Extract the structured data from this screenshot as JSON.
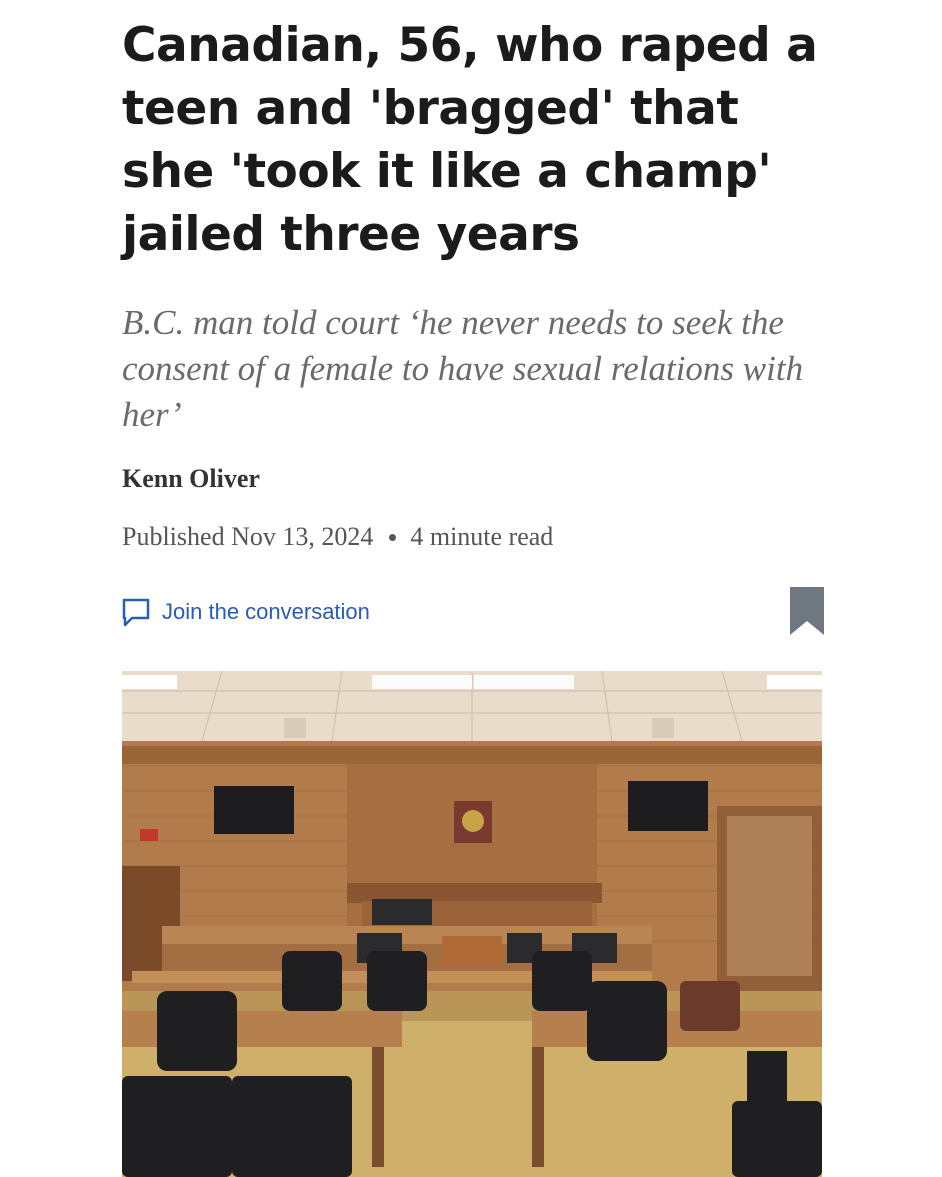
{
  "article": {
    "headline": "Canadian, 56, who raped a teen and 'bragged' that she 'took it like a champ' jailed three years",
    "subheadline": "B.C. man told court ‘he never needs to seek the consent of a female to have sexual relations with her’",
    "author": "Kenn Oliver",
    "published": "Published Nov 13, 2024",
    "read_time": "4 minute read",
    "comment_link": "Join the conversation"
  },
  "icons": {
    "comment": "speech-bubble-icon",
    "bookmark": "bookmark-icon"
  },
  "colors": {
    "headline": "#1b1b1b",
    "subheadline": "#6a6a6a",
    "link": "#2a5bb8",
    "bookmark": "#6f7780",
    "wood": "#b07a4e"
  }
}
